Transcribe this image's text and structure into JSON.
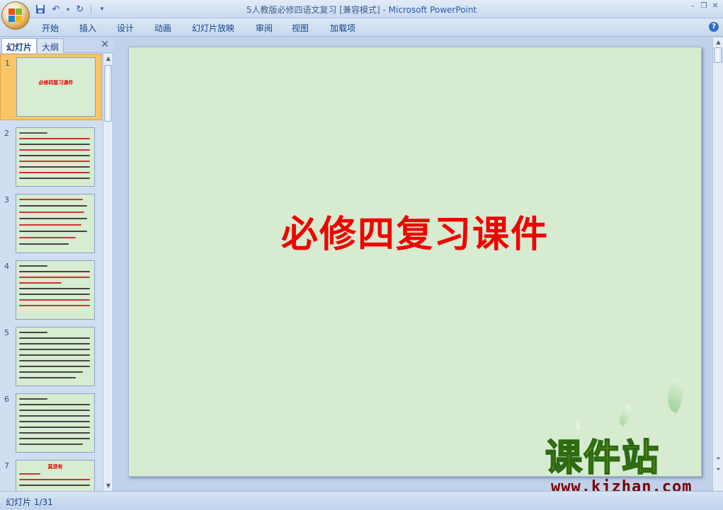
{
  "window": {
    "title_doc": "5人教版必修四语文复习 [兼容模式] - ",
    "title_app": "Microsoft PowerPoint"
  },
  "ribbon": {
    "tabs": [
      "开始",
      "插入",
      "设计",
      "动画",
      "幻灯片放映",
      "审阅",
      "视图",
      "加载项"
    ]
  },
  "left_panel": {
    "tab_slides": "幻灯片",
    "tab_outline": "大纲",
    "thumbnails": [
      {
        "num": "1",
        "title": "必修四复习课件"
      },
      {
        "num": "2"
      },
      {
        "num": "3"
      },
      {
        "num": "4"
      },
      {
        "num": "5"
      },
      {
        "num": "6"
      },
      {
        "num": "7",
        "title": "莫须有"
      }
    ]
  },
  "slide": {
    "title": "必修四复习课件"
  },
  "watermark": {
    "name": "课件站",
    "url": "www.kjzhan.com"
  },
  "status": {
    "slide_indicator": "幻灯片 1/31"
  },
  "colors": {
    "slide_bg": "#d6ebd0",
    "title_red": "#f20000",
    "selected_thumb": "#f8c569"
  }
}
